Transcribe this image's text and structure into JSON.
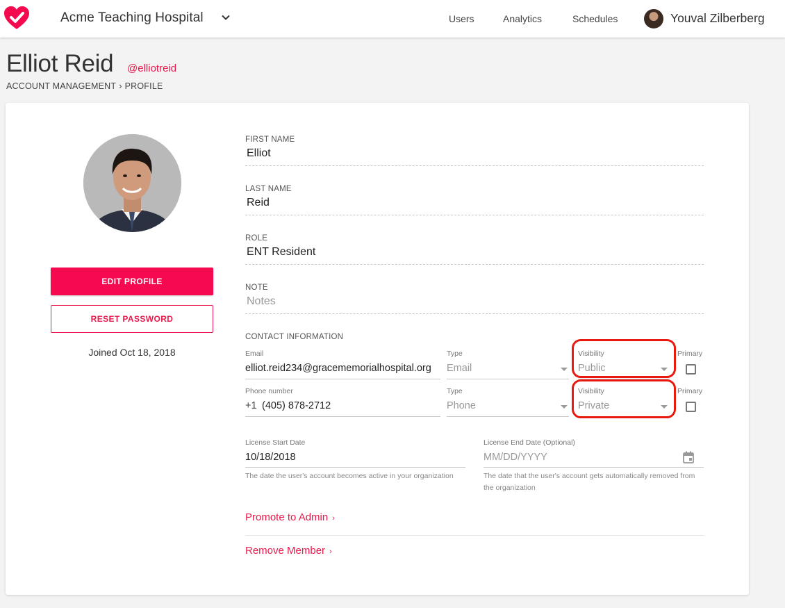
{
  "topbar": {
    "org_name": "Acme Teaching Hospital",
    "nav": [
      "Users",
      "Analytics",
      "Schedules"
    ],
    "user_name": "Youval Zilberberg",
    "brand_color": "#f50a50"
  },
  "header": {
    "name": "Elliot Reid",
    "handle": "@elliotreid",
    "breadcrumb": [
      "ACCOUNT MANAGEMENT",
      "PROFILE"
    ]
  },
  "profile": {
    "edit_label": "EDIT PROFILE",
    "reset_label": "RESET PASSWORD",
    "joined": "Joined Oct 18, 2018"
  },
  "form": {
    "first_name": {
      "label": "FIRST NAME",
      "value": "Elliot"
    },
    "last_name": {
      "label": "LAST NAME",
      "value": "Reid"
    },
    "role": {
      "label": "ROLE",
      "value": "ENT Resident"
    },
    "note": {
      "label": "NOTE",
      "placeholder": "Notes"
    }
  },
  "contact": {
    "section_label": "CONTACT INFORMATION",
    "email": {
      "label": "Email",
      "value": "elliot.reid234@gracememorialhospital.org",
      "type_label": "Type",
      "type_value": "Email",
      "visibility_label": "Visibility",
      "visibility_value": "Public",
      "primary_label": "Primary",
      "primary_checked": false
    },
    "phone": {
      "label": "Phone number",
      "prefix": "+1",
      "value": "(405) 878-2712",
      "type_label": "Type",
      "type_value": "Phone",
      "visibility_label": "Visibility",
      "visibility_value": "Private",
      "primary_label": "Primary",
      "primary_checked": false
    }
  },
  "license": {
    "start_label": "License Start Date",
    "start_value": "10/18/2018",
    "start_helper": "The date the user's account becomes active in your organization",
    "end_label": "License End Date (Optional)",
    "end_placeholder": "MM/DD/YYYY",
    "end_helper": "The date that the user's account gets automatically removed from the organization"
  },
  "actions": {
    "promote": "Promote to Admin",
    "remove": "Remove Member",
    "chevron": "›"
  }
}
